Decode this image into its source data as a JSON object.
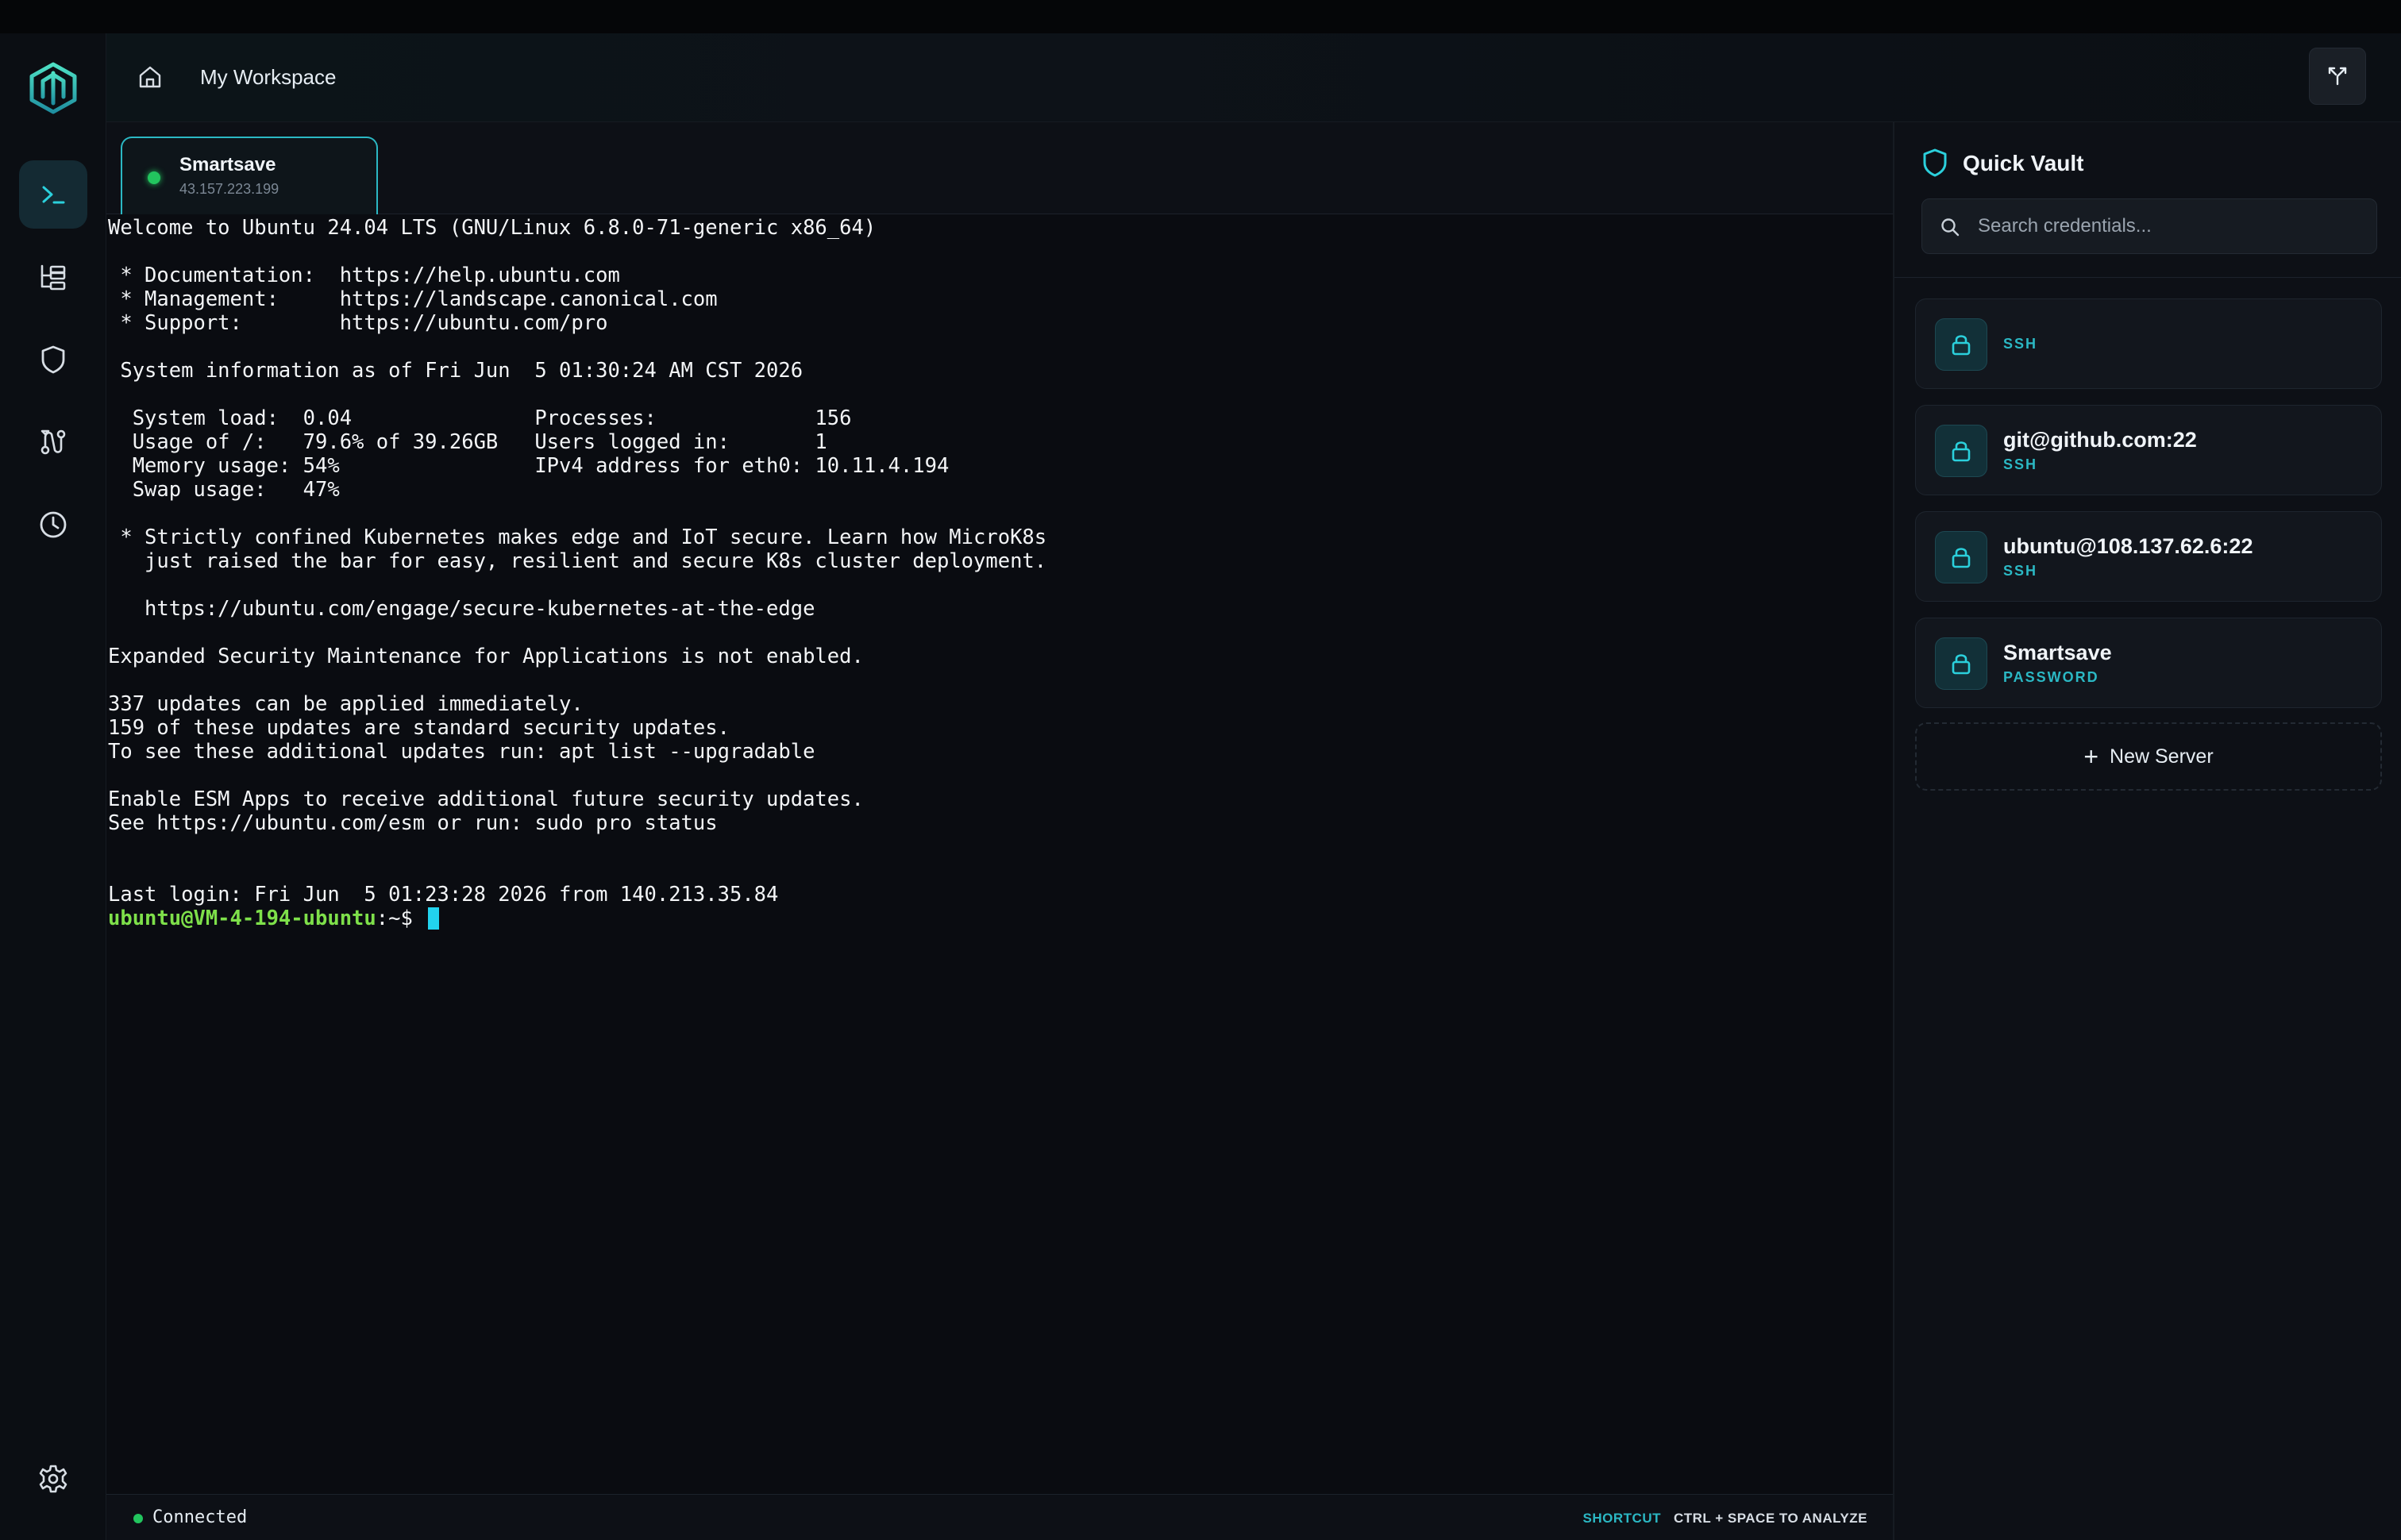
{
  "header": {
    "workspace_title": "My Workspace"
  },
  "tab": {
    "name": "Smartsave",
    "ip": "43.157.223.199",
    "status_color": "#22c55e"
  },
  "terminal": {
    "lines": [
      "Welcome to Ubuntu 24.04 LTS (GNU/Linux 6.8.0-71-generic x86_64)",
      "",
      " * Documentation:  https://help.ubuntu.com",
      " * Management:     https://landscape.canonical.com",
      " * Support:        https://ubuntu.com/pro",
      "",
      " System information as of Fri Jun  5 01:30:24 AM CST 2026",
      "",
      "  System load:  0.04               Processes:             156",
      "  Usage of /:   79.6% of 39.26GB   Users logged in:       1",
      "  Memory usage: 54%                IPv4 address for eth0: 10.11.4.194",
      "  Swap usage:   47%",
      "",
      " * Strictly confined Kubernetes makes edge and IoT secure. Learn how MicroK8s",
      "   just raised the bar for easy, resilient and secure K8s cluster deployment.",
      "",
      "   https://ubuntu.com/engage/secure-kubernetes-at-the-edge",
      "",
      "Expanded Security Maintenance for Applications is not enabled.",
      "",
      "337 updates can be applied immediately.",
      "159 of these updates are standard security updates.",
      "To see these additional updates run: apt list --upgradable",
      "",
      "Enable ESM Apps to receive additional future security updates.",
      "See https://ubuntu.com/esm or run: sudo pro status",
      "",
      "",
      "Last login: Fri Jun  5 01:23:28 2026 from 140.213.35.84"
    ],
    "prompt_user": "ubuntu@VM-4-194-ubuntu",
    "prompt_path": ":~$ "
  },
  "status": {
    "connection": "Connected",
    "shortcut_label": "SHORTCUT",
    "shortcut_keys": "CTRL + SPACE TO ANALYZE"
  },
  "vault": {
    "title": "Quick Vault",
    "search_placeholder": "Search credentials...",
    "credentials": [
      {
        "name": "",
        "type": "SSH"
      },
      {
        "name": "git@github.com:22",
        "type": "SSH"
      },
      {
        "name": "ubuntu@108.137.62.6:22",
        "type": "SSH"
      },
      {
        "name": "Smartsave",
        "type": "PASSWORD"
      }
    ],
    "new_server_label": "New Server"
  },
  "sidebar": {
    "items": [
      {
        "icon": "terminal-icon",
        "active": true
      },
      {
        "icon": "folder-tree-icon",
        "active": false
      },
      {
        "icon": "shield-icon",
        "active": false
      },
      {
        "icon": "route-icon",
        "active": false
      },
      {
        "icon": "history-clock-icon",
        "active": false
      }
    ],
    "bottom_icon": "settings-gear-icon"
  },
  "colors": {
    "accent": "#2bb8c4",
    "prompt_green": "#7ee04a",
    "online_green": "#22c55e",
    "cursor": "#22d3ee"
  }
}
